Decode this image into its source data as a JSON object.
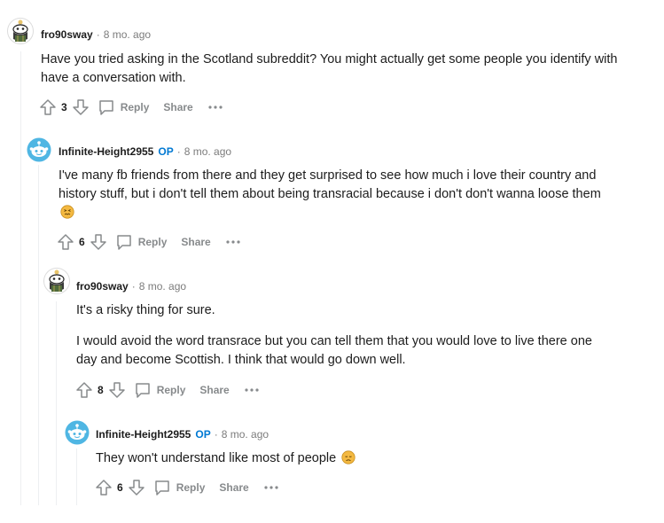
{
  "comments": [
    {
      "author": "fro90sway",
      "is_op": false,
      "op_label": "",
      "separator": "·",
      "time": "8 mo. ago",
      "paragraphs": [
        "Have you tried asking in the Scotland subreddit? You might actually get some people you identify with have a conversation with."
      ],
      "score": "3",
      "reply_label": "Reply",
      "share_label": "Share",
      "avatar_icon": "snoo-kilt-avatar"
    },
    {
      "author": "Infinite-Height2955",
      "is_op": true,
      "op_label": "OP",
      "separator": "·",
      "time": "8 mo. ago",
      "paragraphs": [
        "I've many fb friends from there and they get surprised to see how much i love their country and history stuff, but i don't tell them about being transracial because i don't don't wanna loose them"
      ],
      "emoji": "confounded-face-emoji",
      "score": "6",
      "reply_label": "Reply",
      "share_label": "Share",
      "avatar_icon": "default-snoo-avatar"
    },
    {
      "author": "fro90sway",
      "is_op": false,
      "op_label": "",
      "separator": "·",
      "time": "8 mo. ago",
      "paragraphs": [
        "It's a risky thing for sure.",
        "I would avoid the word transrace but you can tell them that you would love to live there one day and become Scottish. I think that would go down well."
      ],
      "score": "8",
      "reply_label": "Reply",
      "share_label": "Share",
      "avatar_icon": "snoo-kilt-avatar"
    },
    {
      "author": "Infinite-Height2955",
      "is_op": true,
      "op_label": "OP",
      "separator": "·",
      "time": "8 mo. ago",
      "paragraphs": [
        "They won't understand like most of people"
      ],
      "emoji": "disappointed-face-emoji",
      "score": "6",
      "reply_label": "Reply",
      "share_label": "Share",
      "avatar_icon": "default-snoo-avatar"
    }
  ],
  "colors": {
    "op": "#0079d3",
    "meta": "#7c7c7c",
    "action": "#878a8c",
    "thread_line": "#edeff1",
    "snoo_blue": "#4fb6e3"
  }
}
